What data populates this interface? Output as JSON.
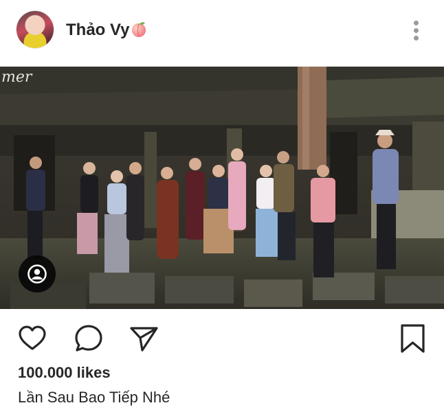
{
  "post": {
    "username": "Thảo Vy",
    "likes": "100.000 likes",
    "caption": "Lần Sau Bao Tiếp Nhé",
    "photo_watermark": "mer"
  },
  "icons": {
    "avatar": "profile-photo",
    "badge": "peach-emoji",
    "more": "three-dots-vertical-icon",
    "tag": "person-tag-icon",
    "like": "heart-icon",
    "comment": "speech-bubble-icon",
    "share": "paper-plane-icon",
    "save": "bookmark-icon"
  },
  "colors": {
    "text": "#262626",
    "icon_gray": "#9a9a9a",
    "peach": "#f48a8a"
  }
}
